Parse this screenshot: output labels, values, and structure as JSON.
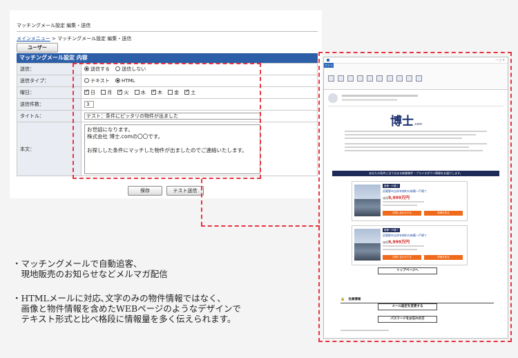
{
  "settings": {
    "page_title": "マッチングメール設定 編集・送信",
    "breadcrumb_link": "メインメニュー",
    "breadcrumb_rest": " > マッチングメール設定 編集・送信",
    "user_button": "ユーザー",
    "section_header": "マッチングメール設定 内容",
    "rows": {
      "send_label": "送信：",
      "send_on": "送信する",
      "send_off": "送信しない",
      "type_label": "送信タイプ：",
      "type_text": "テキスト",
      "type_html": "HTML",
      "days_label": "曜日：",
      "days": [
        "日",
        "月",
        "火",
        "水",
        "木",
        "金",
        "土"
      ],
      "days_checked": [
        true,
        false,
        true,
        false,
        true,
        false,
        true
      ],
      "count_label": "送信件数：",
      "count_value": "3",
      "title_label": "タイトル：",
      "title_value": "テスト：条件にピッタリの物件が出ました",
      "body_label": "本文：",
      "body_lines": [
        "お世話になります。",
        "株式会社 博士.comの〇〇です。",
        "",
        "お探しした条件にマッチした物件が出ましたのでご連絡いたします。"
      ]
    },
    "save_button": "保存",
    "test_button": "テスト送信"
  },
  "bullets": {
    "b1_line1": "・マッチングメールで自動追客、",
    "b1_line2": "　現地販売のお知らせなどメルマガ配信",
    "b2_line1": "・HTMLメールに対応､文字のみの物件情報ではなく､",
    "b2_line2": "　画像と物件情報を含めたWEBページのようなデザインで",
    "b2_line3": "　テキスト形式と比べ格段に情報量を多く伝えられます。"
  },
  "email": {
    "ribbon_tab": "ファイル",
    "logo": "博士",
    "logo_suffix": ".com",
    "banner": "あなたの条件に当てはまる新着物件・プライスダウン情報をお届けします。",
    "listing_tag": "新築一戸建て",
    "listing_title": "武蔵野市吉祥寺南町の新築一戸建て",
    "price_label": "価格",
    "price": "9,999万円",
    "inquiry_btn": "お問い合わせする",
    "detail_btn": "詳細を見る",
    "top_btn": "トップページへ",
    "member_title": "会員情報",
    "mail_settings_btn": "メール設定を変更する",
    "password_btn": "パスワードをお忘れの方"
  },
  "colors": {
    "accent_dash": "#e53241",
    "header_blue": "#2d5fa8",
    "navy": "#1e2a57",
    "orange": "#ef6a1a"
  }
}
